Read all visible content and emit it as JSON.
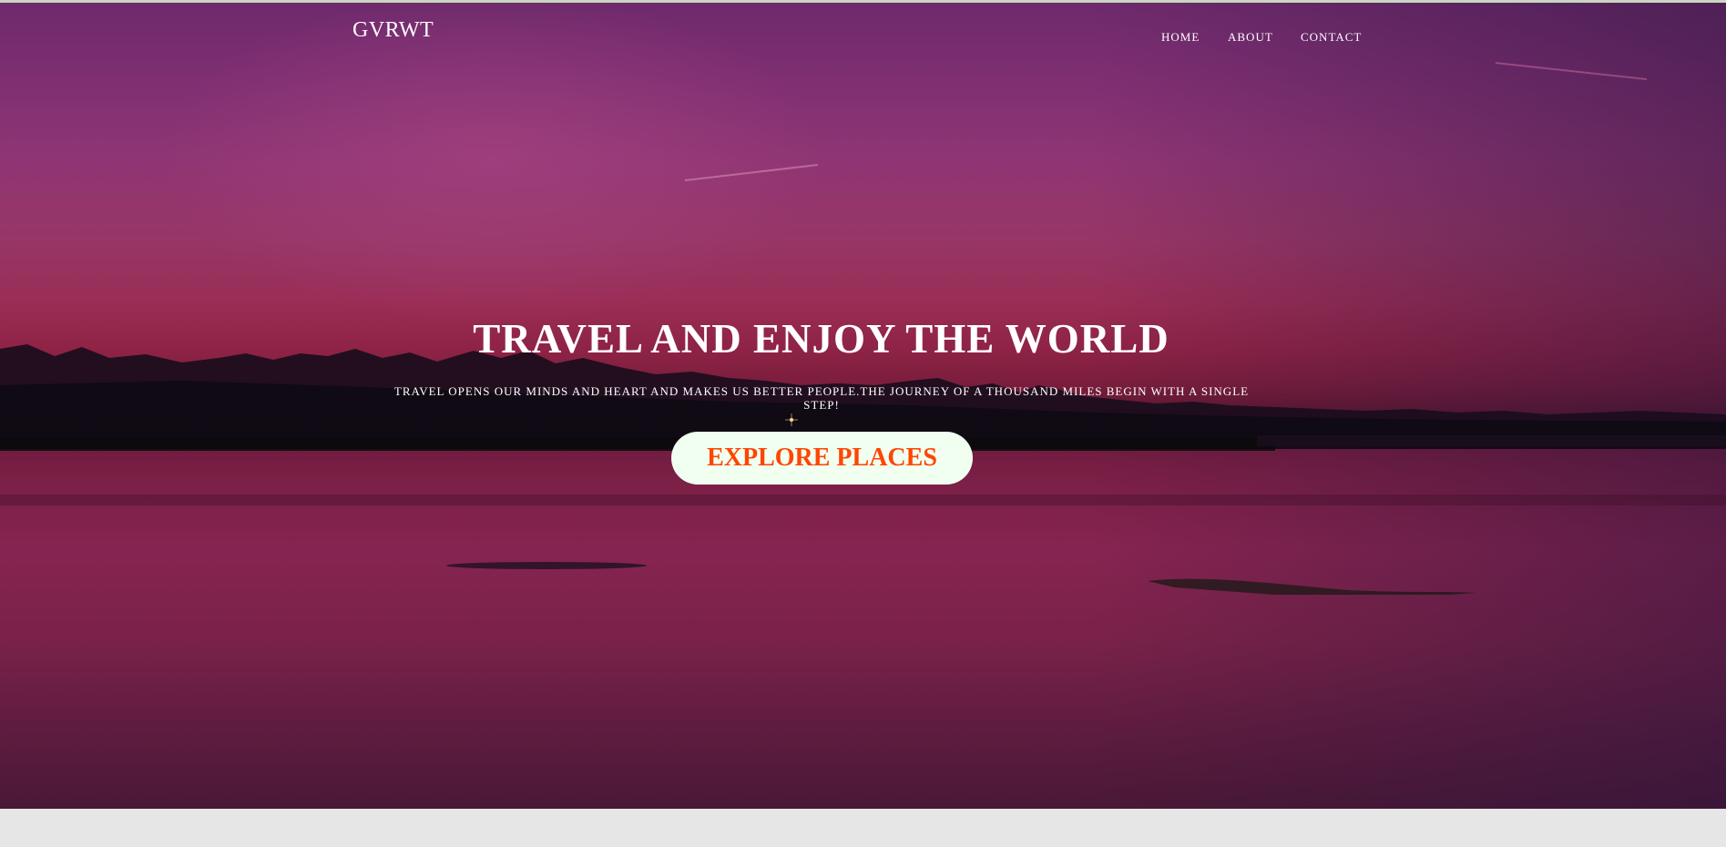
{
  "brand": {
    "name": "GVRWT"
  },
  "nav": {
    "items": [
      {
        "label": "HOME"
      },
      {
        "label": "ABOUT"
      },
      {
        "label": "CONTACT"
      }
    ]
  },
  "hero": {
    "title": "TRAVEL AND ENJOY THE WORLD",
    "subtitle": "TRAVEL OPENS OUR MINDS AND HEART AND MAKES US BETTER PEOPLE.THE JOURNEY OF A THOUSAND MILES BEGIN WITH A SINGLE STEP!",
    "cta_label": "EXPLORE PLACES",
    "background_image": "sunset-lake-mountains"
  },
  "colors": {
    "cta_text": "#ff4500",
    "cta_background": "#f0fff0",
    "text": "#ffffff",
    "hero_tint": "#8f3574",
    "page_background": "#e6e6e6"
  }
}
